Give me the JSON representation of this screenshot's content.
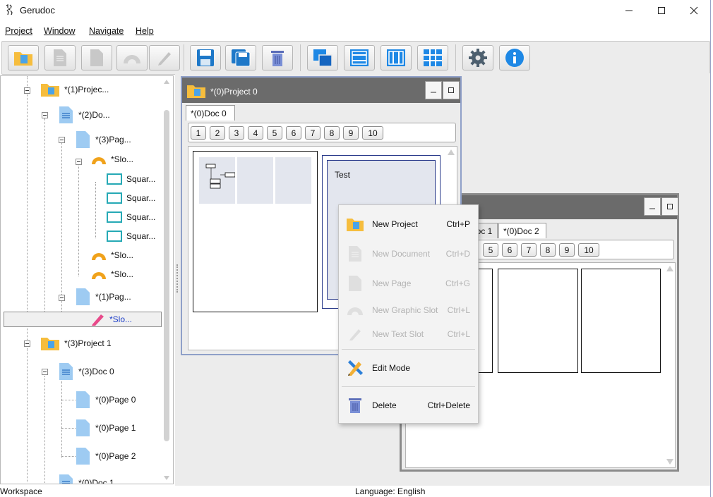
{
  "window": {
    "title": "Gerudoc"
  },
  "menu": [
    "Project",
    "Window",
    "Navigate",
    "Help"
  ],
  "toolbar": {
    "buttons": [
      "new-project",
      "new-document",
      "new-page",
      "new-graphic-slot",
      "new-text-slot",
      "save",
      "save-all",
      "delete",
      "cascade",
      "tile-horizontal",
      "tile-vertical",
      "tile-grid",
      "settings",
      "info"
    ]
  },
  "tree": {
    "nodes": [
      "*(1)Projec...",
      "*(2)Do...",
      "*(3)Pag...",
      "*Slo...",
      "Squar...",
      "Squar...",
      "Squar...",
      "Squar...",
      "*Slo...",
      "*Slo...",
      "*(1)Pag...",
      "*Slo...",
      "*(3)Project 1",
      "*(3)Doc 0",
      "*(0)Page 0",
      "*(0)Page 1",
      "*(0)Page 2",
      "*(0)Doc 1"
    ]
  },
  "frame1": {
    "title": "*(0)Project 0",
    "tabs": [
      "*(0)Doc 0"
    ],
    "page_buttons": [
      "1",
      "2",
      "3",
      "4",
      "5",
      "6",
      "7",
      "8",
      "9",
      "10"
    ],
    "slot_text": "Test"
  },
  "frame2": {
    "tabs": [
      "Doc 1",
      "*(0)Doc 2"
    ],
    "page_buttons": [
      "5",
      "6",
      "7",
      "8",
      "9",
      "10"
    ]
  },
  "context_menu": {
    "items": [
      {
        "label": "New Project",
        "shortcut": "Ctrl+P",
        "enabled": true
      },
      {
        "label": "New Document",
        "shortcut": "Ctrl+D",
        "enabled": false
      },
      {
        "label": "New Page",
        "shortcut": "Ctrl+G",
        "enabled": false
      },
      {
        "label": "New Graphic Slot",
        "shortcut": "Ctrl+L",
        "enabled": false
      },
      {
        "label": "New Text Slot",
        "shortcut": "Ctrl+L",
        "enabled": false
      },
      {
        "label": "Edit Mode",
        "shortcut": "",
        "enabled": true
      },
      {
        "label": "Delete",
        "shortcut": "Ctrl+Delete",
        "enabled": true
      }
    ]
  },
  "status": {
    "left": "Workspace",
    "language": "Language: English"
  },
  "colors": {
    "accent_blue": "#1e88e5",
    "doc_blue": "#9ecbf2",
    "folder_yellow": "#f6bd3d",
    "frame_title": "#6b6b6b",
    "selected_text": "#1a3cc8"
  }
}
